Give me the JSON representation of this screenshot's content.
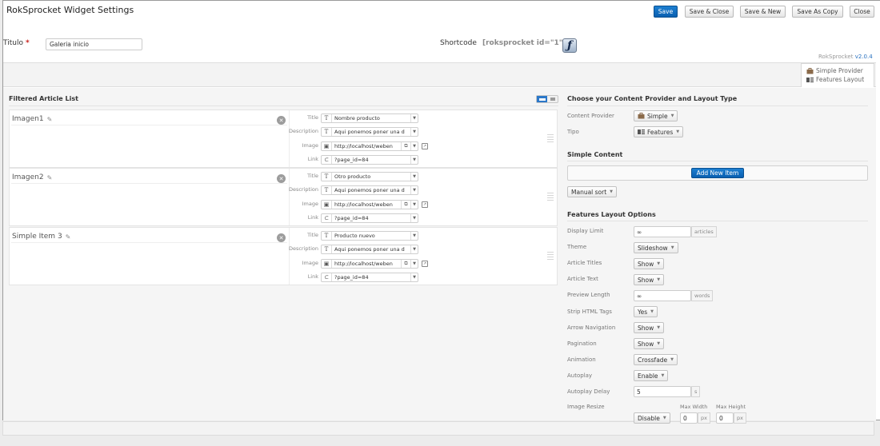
{
  "header": {
    "title": "RokSprocket Widget Settings"
  },
  "toolbar": {
    "save": "Save",
    "save_close": "Save & Close",
    "save_new": "Save & New",
    "save_copy": "Save As Copy",
    "close": "Close"
  },
  "form": {
    "titulo_label": "Titulo",
    "required_mark": "*",
    "titulo_value": "Galeria inicio",
    "shortcode_label": "Shortcode",
    "shortcode_value": "[roksprocket id=\"1\"]"
  },
  "version": {
    "name": "RokSprocket",
    "number": "v2.0.4"
  },
  "provider_badge": {
    "provider": "Simple Provider",
    "layout": "Features Layout"
  },
  "article_list": {
    "title": "Filtered Article List",
    "field_labels": {
      "title": "Title",
      "description": "Description",
      "image": "Image",
      "link": "Link"
    },
    "items": [
      {
        "name": "Imagen1",
        "title": "Nombre producto",
        "description": "Aqui ponemos poner una d",
        "image": "http://localhost/weben",
        "link": "?page_id=84"
      },
      {
        "name": "Imagen2",
        "title": "Otro producto",
        "description": "Aqui ponemos poner una d",
        "image": "http://localhost/weben",
        "link": "?page_id=84"
      },
      {
        "name": "Simple Item 3",
        "title": "Producto nuevo",
        "description": "Aqui ponemos poner una d",
        "image": "http://localhost/weben",
        "link": "?page_id=84"
      }
    ]
  },
  "provider_section": {
    "title": "Choose your Content Provider and Layout Type",
    "content_provider_label": "Content Provider",
    "content_provider_value": "Simple",
    "tipo_label": "Tipo",
    "tipo_value": "Features"
  },
  "simple_content": {
    "title": "Simple Content",
    "add_button": "Add New Item",
    "sort_value": "Manual sort"
  },
  "layout_options": {
    "title": "Features Layout Options",
    "display_limit": {
      "label": "Display Limit",
      "value": "∞",
      "suffix": "articles"
    },
    "theme": {
      "label": "Theme",
      "value": "Slideshow"
    },
    "article_titles": {
      "label": "Article Titles",
      "value": "Show"
    },
    "article_text": {
      "label": "Article Text",
      "value": "Show"
    },
    "preview_length": {
      "label": "Preview Length",
      "value": "∞",
      "suffix": "words"
    },
    "strip_html": {
      "label": "Strip HTML Tags",
      "value": "Yes"
    },
    "arrow_nav": {
      "label": "Arrow Navigation",
      "value": "Show"
    },
    "pagination": {
      "label": "Pagination",
      "value": "Show"
    },
    "animation": {
      "label": "Animation",
      "value": "Crossfade"
    },
    "autoplay": {
      "label": "Autoplay",
      "value": "Enable"
    },
    "autoplay_delay": {
      "label": "Autoplay Delay",
      "value": "5",
      "suffix": "s"
    },
    "image_resize": {
      "label": "Image Resize",
      "value": "Disable",
      "max_width_label": "Max Width",
      "max_width_value": "0",
      "max_height_label": "Max Height",
      "max_height_value": "0",
      "unit": "px"
    }
  },
  "colors": {
    "primary_button": "#0a5fb0",
    "required": "#c8201c",
    "version_link": "#2a72c0"
  }
}
